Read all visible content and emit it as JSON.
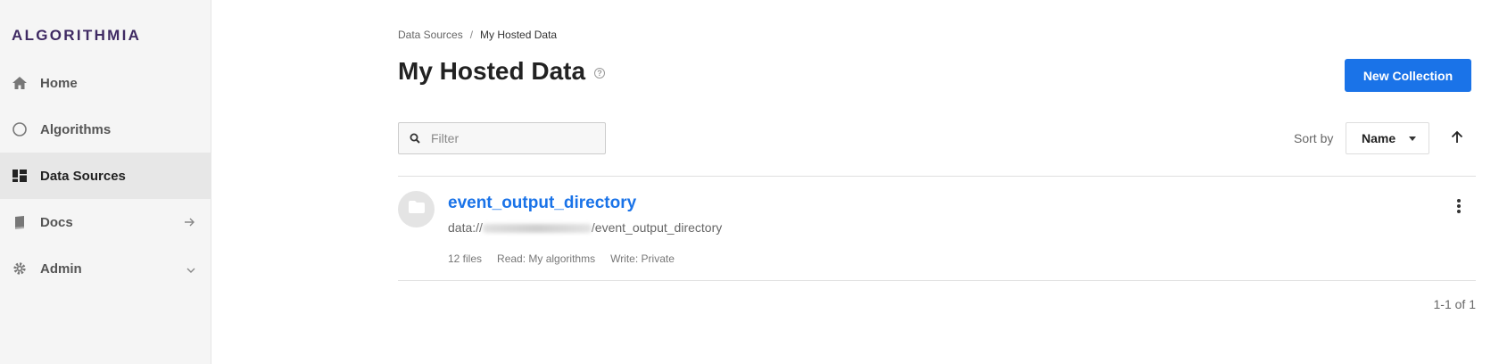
{
  "sidebar": {
    "logo": "ALGORITHMIA",
    "items": [
      {
        "label": "Home",
        "icon": "home-icon"
      },
      {
        "label": "Algorithms",
        "icon": "circle-icon"
      },
      {
        "label": "Data Sources",
        "icon": "data-sources-icon",
        "active": true
      },
      {
        "label": "Docs",
        "icon": "book-icon",
        "trail": "arrow-right-icon"
      },
      {
        "label": "Admin",
        "icon": "gear-icon",
        "trail": "chevron-down-icon"
      }
    ]
  },
  "breadcrumb": {
    "parent": "Data Sources",
    "separator": "/",
    "current": "My Hosted Data"
  },
  "header": {
    "title": "My Hosted Data",
    "help_icon": "help-icon",
    "new_button": "New Collection"
  },
  "controls": {
    "filter_placeholder": "Filter",
    "sort_label": "Sort by",
    "sort_value": "Name",
    "sort_direction_icon": "arrow-up-icon"
  },
  "collections": [
    {
      "name": "event_output_directory",
      "path_prefix": "data://",
      "path_suffix": "/event_output_directory",
      "files": "12 files",
      "read": "Read: My algorithms",
      "write": "Write: Private"
    }
  ],
  "pagination": "1-1 of 1",
  "colors": {
    "accent": "#1a73e8",
    "logo": "#3f2a63",
    "sidebar_bg": "#f5f5f5",
    "active_bg": "#e7e7e7"
  }
}
